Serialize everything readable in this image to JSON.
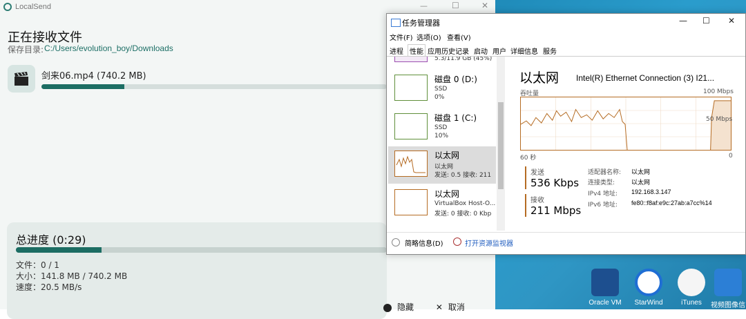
{
  "localsend": {
    "app_title": "LocalSend",
    "heading": "正在接收文件",
    "save_dir_label": "保存目录:",
    "save_dir_value": "C:/Users/evolution_boy/Downloads",
    "file": {
      "name": "剑来06.mp4 (740.2 MB)",
      "progress": 0.24
    },
    "total": {
      "label": "总进度 (0:29)",
      "progress": 0.23,
      "files": "文件：0 / 1",
      "size": "大小：141.8 MB / 740.2 MB",
      "speed": "速度：20.5 MB/s"
    },
    "actions": {
      "hide": "隐藏",
      "cancel": "取消"
    }
  },
  "taskmgr": {
    "title": "任务管理器",
    "menu": [
      "文件(F)",
      "选项(O)",
      "查看(V)"
    ],
    "tabs": [
      "进程",
      "性能",
      "应用历史记录",
      "启动",
      "用户",
      "详细信息",
      "服务"
    ],
    "active_tab": "性能",
    "list": {
      "memory_sub": "5.3/11.9 GB (45%)",
      "items": [
        {
          "name": "磁盘 0 (D:)",
          "sub": "SSD",
          "sub2": "0%"
        },
        {
          "name": "磁盘 1 (C:)",
          "sub": "SSD",
          "sub2": "10%"
        },
        {
          "name": "以太网",
          "sub": "以太网",
          "sub2": "发送: 0.5 接收: 211"
        },
        {
          "name": "以太网",
          "sub": "VirtualBox Host-O...",
          "sub2": "发送: 0 接收: 0 Kbp"
        }
      ]
    },
    "detail": {
      "title": "以太网",
      "adapter": "Intel(R) Ethernet Connection (3) I21...",
      "graph_label": "吞吐量",
      "graph_max": "100 Mbps",
      "graph_mid": "50 Mbps",
      "graph_left": "60 秒",
      "graph_right": "0",
      "send_label": "发送",
      "send_value": "536 Kbps",
      "recv_label": "接收",
      "recv_value": "211 Mbps",
      "props": [
        {
          "k": "适配器名称:",
          "v": "以太网"
        },
        {
          "k": "连接类型:",
          "v": "以太网"
        },
        {
          "k": "IPv4 地址:",
          "v": "192.168.3.147"
        },
        {
          "k": "IPv6 地址:",
          "v": "fe80::f8af:e9c:27ab:a7cc%14"
        }
      ]
    },
    "footer": {
      "fewer": "简略信息(D)",
      "resmon": "打开资源监视器"
    }
  },
  "desktop": {
    "icons": [
      "Oracle VM",
      "StarWind",
      "iTunes",
      "视频图像信"
    ]
  },
  "colors": {
    "accent": "#1c6d63",
    "graph": "#b56b22"
  }
}
